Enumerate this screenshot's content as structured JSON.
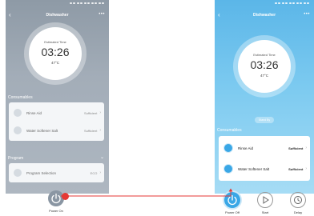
{
  "left": {
    "title": "Dishwasher",
    "estimated_label": "Estimated Time",
    "time": "03:26",
    "temp": "47°C",
    "consumables_label": "Consumables",
    "rinse_label": "Rinse Aid",
    "rinse_value": "Sufficient",
    "salt_label": "Water Softener Salt",
    "salt_value": "Sufficient",
    "program_label": "Program",
    "program_item": "Program Selection",
    "program_value": "ECO",
    "power_label": "Power On"
  },
  "right": {
    "title": "Dishwasher",
    "estimated_label": "Estimated Time",
    "time": "03:26",
    "temp": "47°C",
    "stand_by": "Stand By",
    "consumables_label": "Consumables",
    "rinse_label": "Rinse Aid",
    "rinse_value": "Sufficient",
    "salt_label": "Water Softener Salt",
    "salt_value": "Sufficient",
    "power_off_label": "Power Off",
    "start_label": "Start",
    "delay_label": "Delay"
  },
  "colors": {
    "left_accent": "#9aa6b2",
    "right_accent": "#3aa7e6",
    "connector": "#e53935"
  },
  "icons": {
    "back": "chevron-left-icon",
    "more": "more-dots-icon",
    "power": "power-icon",
    "start": "play-icon",
    "delay": "clock-icon"
  }
}
